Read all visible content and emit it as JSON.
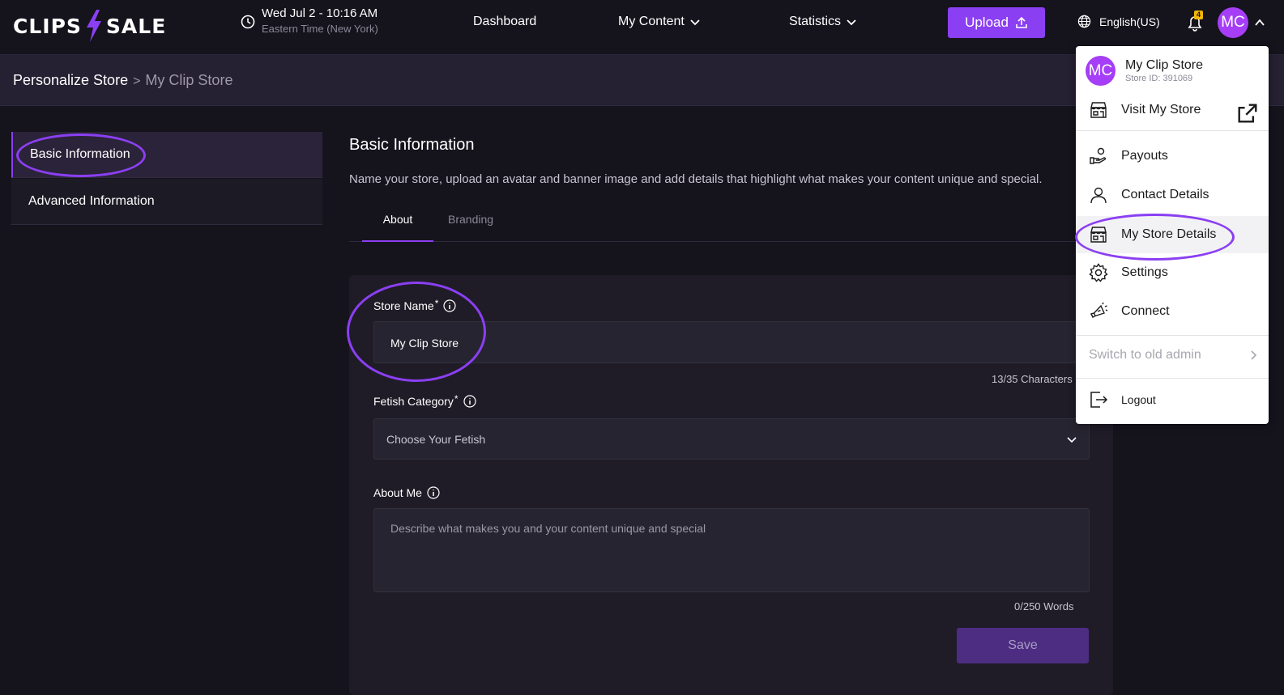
{
  "header": {
    "logo_left": "CLIPS",
    "logo_right": "SALE",
    "datetime": "Wed Jul 2 - 10:16 AM",
    "timezone": "Eastern Time (New York)",
    "nav": {
      "dashboard": "Dashboard",
      "my_content": "My Content",
      "statistics": "Statistics"
    },
    "upload_label": "Upload",
    "language": "English(US)",
    "notifications_count": "4",
    "avatar_initials": "MC"
  },
  "breadcrumb": {
    "parent": "Personalize Store",
    "separator": ">",
    "current": "My Clip Store"
  },
  "sidebar": {
    "items": [
      {
        "label": "Basic Information",
        "active": true
      },
      {
        "label": "Advanced Information",
        "active": false
      }
    ]
  },
  "main": {
    "title": "Basic Information",
    "description": "Name your store, upload an avatar and banner image and add details that highlight what makes your content unique and special.",
    "tabs": [
      {
        "label": "About",
        "active": true
      },
      {
        "label": "Branding",
        "active": false
      }
    ],
    "form": {
      "store_name_label": "Store Name",
      "store_name_value": "My Clip Store",
      "store_name_counter": "13/35 Characters",
      "fetish_label": "Fetish Category",
      "fetish_value": "Choose Your Fetish",
      "about_label": "About Me",
      "about_placeholder": "Describe what makes you and your content unique and special",
      "about_counter": "0/250 Words",
      "required_mark": "*",
      "save_label": "Save"
    }
  },
  "dropdown": {
    "avatar_initials": "MC",
    "store_name": "My Clip Store",
    "store_id": "Store ID: 391069",
    "items": {
      "visit": "Visit My Store",
      "payouts": "Payouts",
      "contact": "Contact Details",
      "store_details": "My Store Details",
      "settings": "Settings",
      "connect": "Connect",
      "switch_admin": "Switch to old admin",
      "logout": "Logout"
    }
  },
  "colors": {
    "accent": "#8b3ff2",
    "avatar": "#a53ef6",
    "background": "#15131c",
    "badge": "#f2b705"
  }
}
